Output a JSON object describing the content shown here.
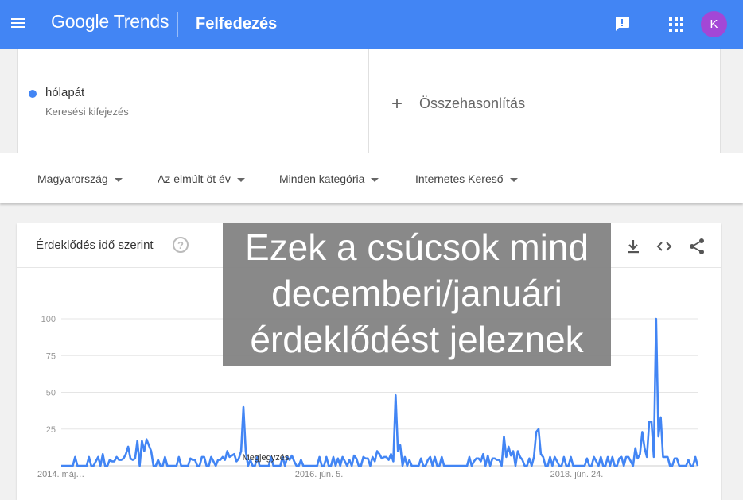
{
  "header": {
    "logo_google": "Google",
    "logo_trends": "Trends",
    "section": "Felfedezés",
    "avatar_letter": "K",
    "color": "#4285f4"
  },
  "search": {
    "term": "hólapát",
    "term_type": "Keresési kifejezés",
    "term_color": "#4285f4",
    "compare_label": "Összehasonlítás"
  },
  "filters": {
    "region": "Magyarország",
    "period": "Az elmúlt öt év",
    "category": "Minden kategória",
    "source": "Internetes Kereső"
  },
  "chart_card": {
    "title": "Érdeklődés idő szerint",
    "help": "?",
    "icons": [
      "download-icon",
      "embed-icon",
      "share-icon"
    ]
  },
  "overlay": {
    "lines": [
      "Ezek a csúcsok mind",
      "decemberi/januári",
      "érdeklődést jeleznek"
    ]
  },
  "chart_data": {
    "type": "line",
    "series": [
      {
        "color": "#4285f4",
        "values": [
          0,
          0,
          0,
          0,
          0,
          0,
          6,
          0,
          0,
          0,
          0,
          0,
          6,
          0,
          0,
          3,
          6,
          0,
          8,
          0,
          0,
          4,
          3,
          3,
          6,
          4,
          4,
          5,
          8,
          13,
          5,
          4,
          5,
          17,
          0,
          17,
          10,
          18,
          14,
          10,
          0,
          0,
          4,
          0,
          0,
          6,
          0,
          0,
          0,
          0,
          0,
          6,
          0,
          0,
          0,
          0,
          5,
          4,
          4,
          0,
          0,
          6,
          6,
          0,
          0,
          6,
          3,
          0,
          4,
          4,
          6,
          4,
          10,
          6,
          7,
          8,
          3,
          5,
          10,
          40,
          10,
          0,
          4,
          0,
          0,
          6,
          0,
          0,
          0,
          0,
          0,
          6,
          0,
          0,
          0,
          0,
          6,
          0,
          6,
          4,
          7,
          3,
          0,
          0,
          4,
          0,
          0,
          0,
          0,
          0,
          0,
          0,
          6,
          0,
          0,
          6,
          0,
          0,
          6,
          0,
          5,
          0,
          6,
          3,
          0,
          4,
          0,
          7,
          5,
          0,
          0,
          6,
          5,
          5,
          0,
          6,
          3,
          10,
          8,
          5,
          6,
          6,
          4,
          8,
          3,
          48,
          10,
          14,
          0,
          6,
          0,
          4,
          0,
          0,
          0,
          0,
          5,
          0,
          0,
          4,
          6,
          0,
          6,
          0,
          0,
          6,
          0,
          0,
          0,
          0,
          0,
          0,
          0,
          0,
          0,
          0,
          0,
          6,
          0,
          3,
          5,
          5,
          3,
          8,
          0,
          7,
          0,
          5,
          5,
          4,
          4,
          0,
          20,
          6,
          13,
          7,
          10,
          0,
          10,
          6,
          4,
          0,
          0,
          5,
          0,
          6,
          23,
          25,
          8,
          6,
          0,
          0,
          6,
          0,
          6,
          3,
          0,
          0,
          6,
          0,
          0,
          6,
          0,
          0,
          0,
          0,
          0,
          0,
          5,
          0,
          0,
          6,
          3,
          0,
          6,
          0,
          0,
          6,
          0,
          6,
          0,
          0,
          5,
          6,
          0,
          6,
          6,
          3,
          0,
          12,
          5,
          8,
          23,
          12,
          6,
          30,
          30,
          6,
          100,
          20,
          33,
          6,
          6,
          6,
          0,
          0,
          5,
          5,
          0,
          0,
          0,
          0,
          4,
          0,
          0,
          6,
          0
        ]
      }
    ],
    "x_ticks": [
      "2014. máj…",
      "2016. jún. 5.",
      "2018. jún. 24."
    ],
    "y_ticks": [
      25,
      50,
      75,
      100
    ],
    "ylim": [
      0,
      100
    ],
    "note_label": "Megjegyzés",
    "grid": true
  }
}
